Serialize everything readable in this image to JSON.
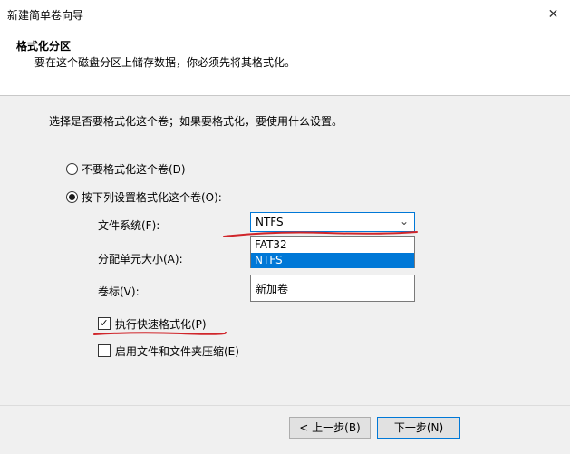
{
  "window": {
    "title": "新建简单卷向导",
    "close_glyph": "✕"
  },
  "header": {
    "title": "格式化分区",
    "subtitle": "要在这个磁盘分区上储存数据，你必须先将其格式化。"
  },
  "content": {
    "instruction": "选择是否要格式化这个卷；如果要格式化，要使用什么设置。",
    "option_no_format": {
      "label": "不要格式化这个卷(D)",
      "checked": false
    },
    "option_format": {
      "label": "按下列设置格式化这个卷(O):",
      "checked": true
    },
    "file_system": {
      "label": "文件系统(F):",
      "value": "NTFS",
      "options": [
        "FAT32",
        "NTFS"
      ],
      "highlighted": "NTFS"
    },
    "allocation_unit": {
      "label": "分配单元大小(A):"
    },
    "volume_label": {
      "label": "卷标(V):",
      "value": "新加卷"
    },
    "quick_format": {
      "label": "执行快速格式化(P)",
      "checked": true
    },
    "compression": {
      "label": "启用文件和文件夹压缩(E)",
      "checked": false
    }
  },
  "footer": {
    "back_label": "< 上一步(B)",
    "next_label": "下一步(N)"
  },
  "annotation_color": "#d0262b"
}
